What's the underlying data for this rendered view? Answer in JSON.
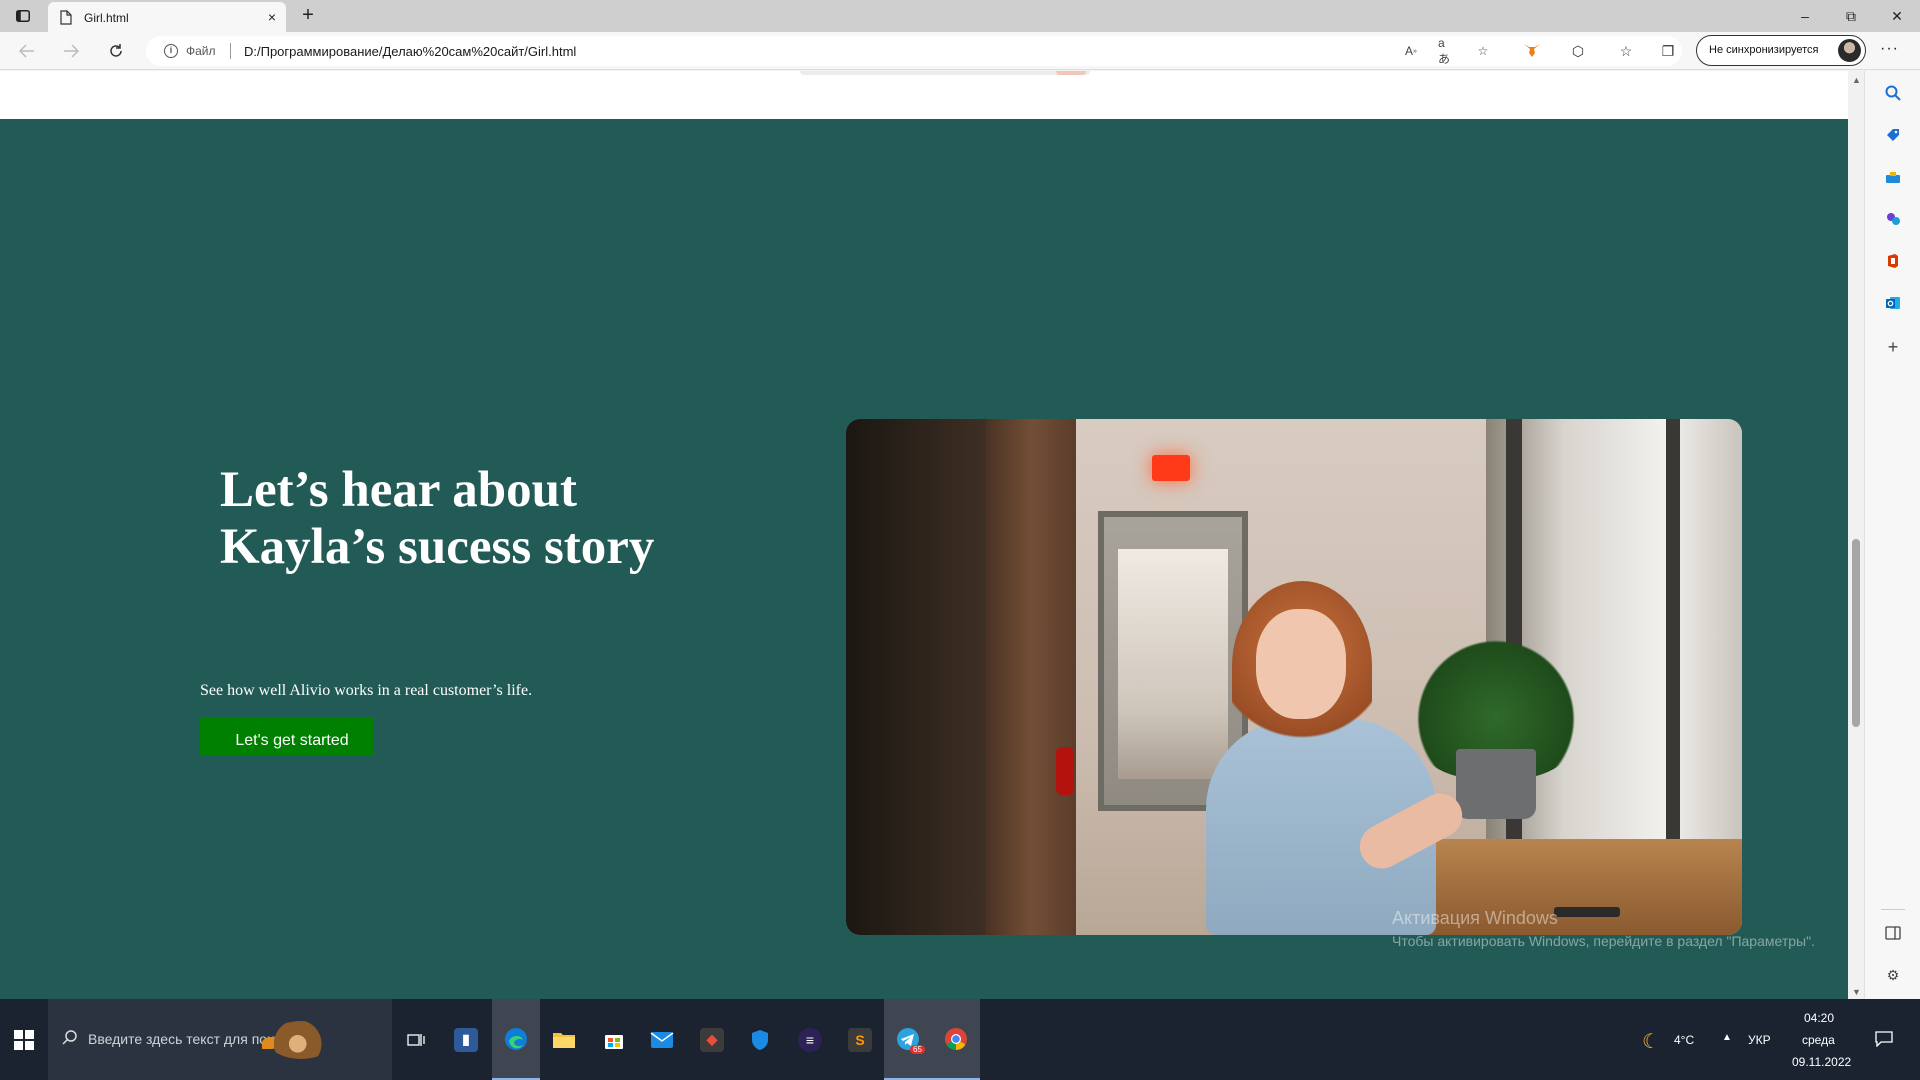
{
  "browser": {
    "tab_title": "Girl.html",
    "new_tab_symbol": "+",
    "close_tab_symbol": "×",
    "address_scheme_label": "Файл",
    "url": "D:/Программирование/Делаю%20сам%20сайт/Girl.html",
    "profile_label": "Не синхронизируется",
    "window_minimize": "–",
    "window_restore": "⧉",
    "window_close": "✕",
    "menu_symbol": "···"
  },
  "hero": {
    "title_line1": "Let’s hear about",
    "title_line2": "Kayla’s sucess story",
    "subtitle": "See how well Alivio works in a real customer’s life.",
    "cta_label": "Let's get started",
    "background_color": "#225b56",
    "cta_color": "#008000"
  },
  "watermark": {
    "title": "Активация Windows",
    "subtitle": "Чтобы активировать Windows, перейдите в раздел \"Параметры\"."
  },
  "taskbar": {
    "search_placeholder": "Введите здесь текст для поиска",
    "weather": "4°C",
    "language": "УКР",
    "time": "04:20",
    "day": "среда",
    "date": "09.11.2022",
    "telegram_badge": "65"
  }
}
